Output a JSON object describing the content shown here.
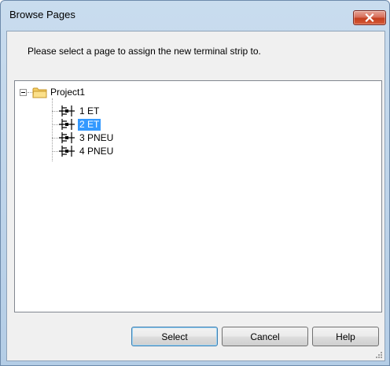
{
  "window": {
    "title": "Browse Pages",
    "close_icon": "close-x-icon"
  },
  "prompt": "Please select a page to assign the new terminal strip to.",
  "tree": {
    "root": {
      "label": "Project1",
      "icon": "folder-icon",
      "expanded": true
    },
    "pages": [
      {
        "label": "1 ET",
        "icon": "terminal-strip-page-icon",
        "selected": false
      },
      {
        "label": "2 ET",
        "icon": "terminal-strip-page-icon",
        "selected": true
      },
      {
        "label": "3 PNEU",
        "icon": "terminal-strip-page-icon",
        "selected": false
      },
      {
        "label": "4 PNEU",
        "icon": "terminal-strip-page-icon",
        "selected": false
      }
    ]
  },
  "buttons": {
    "select": "Select",
    "cancel": "Cancel",
    "help": "Help"
  },
  "colors": {
    "selection": "#3399ff",
    "close_button": "#c4401f",
    "title_gradient": "#c9dcee"
  }
}
